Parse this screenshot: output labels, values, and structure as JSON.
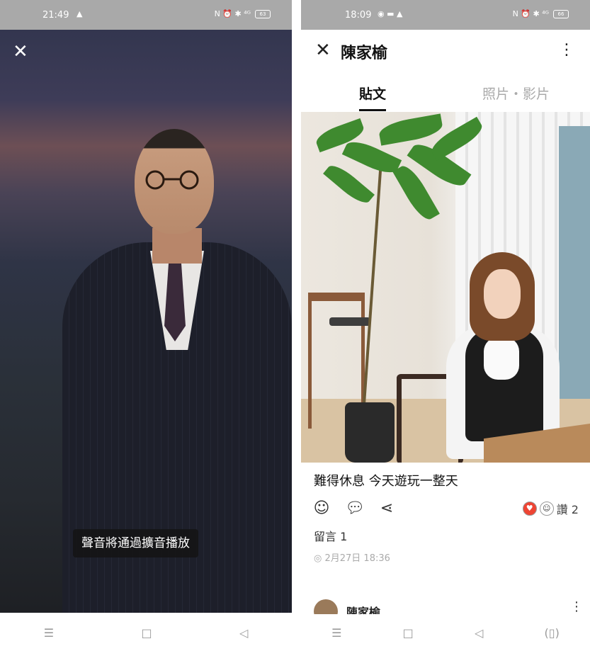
{
  "left_screen": {
    "status_time": "21:49",
    "status_icons": "N ⏰ ✱ ⁴ᴳ",
    "battery": "63",
    "close_icon": "close-icon",
    "caption": "聲音將通過擴音播放",
    "nav": [
      "☰",
      "□",
      "◁"
    ]
  },
  "right_screen": {
    "status_time": "18:09",
    "status_icons": "N ⏰ ✱ ⁴ᴳ",
    "battery": "66",
    "header": {
      "title": "陳家榆"
    },
    "tabs": [
      "貼文",
      "照片・影片"
    ],
    "post": {
      "text": "難得休息 今天遊玩一整天",
      "reaction_label": "讚 2",
      "comments": "留言 1",
      "time": "2月27日 18:36"
    },
    "next_post_author": "陳家榆",
    "nav": [
      "☰",
      "□",
      "◁",
      "(▯)"
    ]
  }
}
